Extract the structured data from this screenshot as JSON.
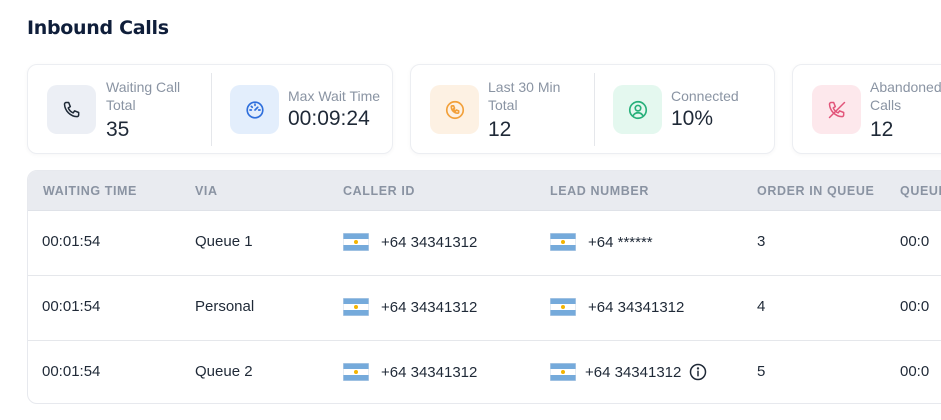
{
  "page": {
    "title": "Inbound Calls"
  },
  "stats": [
    {
      "label_line1": "Waiting Call",
      "label_line2": "Total",
      "value": "35",
      "icon": "phone-icon",
      "icon_bg": "#eceff5",
      "icon_color": "#1f2a37"
    },
    {
      "label_line1": "Max Wait Time",
      "label_line2": "",
      "value": "00:09:24",
      "icon": "speedometer-icon",
      "icon_bg": "#e3eefc",
      "icon_color": "#2f6fdc"
    },
    {
      "label_line1": "Last 30 Min",
      "label_line2": "Total",
      "value": "12",
      "icon": "phone-call-icon",
      "icon_bg": "#fdf1e3",
      "icon_color": "#f2a03a"
    },
    {
      "label_line1": "Connected",
      "label_line2": "",
      "value": "10%",
      "icon": "user-circle-icon",
      "icon_bg": "#e4f8ef",
      "icon_color": "#27b07a"
    },
    {
      "label_line1": "Abandoned",
      "label_line2": "Calls",
      "value": "12",
      "icon": "phone-missed-icon",
      "icon_bg": "#fde8ec",
      "icon_color": "#e2557a"
    }
  ],
  "table": {
    "headers": [
      "WAITING TIME",
      "VIA",
      "CALLER ID",
      "LEAD NUMBER",
      "ORDER IN QUEUE",
      "QUEUE"
    ],
    "rows": [
      {
        "waiting_time": "00:01:54",
        "via": "Queue 1",
        "caller_id": "+64 34341312",
        "lead_number": "+64 ******",
        "order": "3",
        "queue_time": "00:0"
      },
      {
        "waiting_time": "00:01:54",
        "via": "Personal",
        "caller_id": "+64 34341312",
        "lead_number": "+64 34341312",
        "order": "4",
        "queue_time": "00:0"
      },
      {
        "waiting_time": "00:01:54",
        "via": "Queue 2",
        "caller_id": "+64 34341312",
        "lead_number": "+64 34341312",
        "order": "5",
        "queue_time": "00:0"
      }
    ]
  }
}
